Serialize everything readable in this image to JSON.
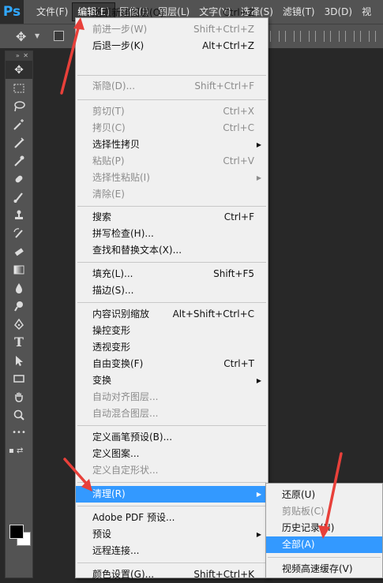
{
  "app": {
    "logo": "Ps"
  },
  "menubar": {
    "items": [
      "文件(F)",
      "编辑(E)",
      "图像(I)",
      "图层(L)",
      "文字(Y)",
      "选择(S)",
      "滤镜(T)",
      "3D(D)",
      "视"
    ]
  },
  "edit_menu": {
    "items": [
      {
        "label": "还原新建图层(O)",
        "shortcut": "Ctrl+Z",
        "disabled": false
      },
      {
        "label": "前进一步(W)",
        "shortcut": "Shift+Ctrl+Z",
        "disabled": true
      },
      {
        "label": "后退一步(K)",
        "shortcut": "Alt+Ctrl+Z",
        "disabled": false
      },
      {
        "label": "渐隐(D)...",
        "shortcut": "Shift+Ctrl+F",
        "disabled": true
      },
      {
        "label": "剪切(T)",
        "shortcut": "Ctrl+X",
        "disabled": true
      },
      {
        "label": "拷贝(C)",
        "shortcut": "Ctrl+C",
        "disabled": true
      },
      {
        "label": "选择性拷贝",
        "shortcut": "",
        "disabled": false,
        "submenu": true
      },
      {
        "label": "粘贴(P)",
        "shortcut": "Ctrl+V",
        "disabled": true
      },
      {
        "label": "选择性粘贴(I)",
        "shortcut": "",
        "disabled": true,
        "submenu": true
      },
      {
        "label": "清除(E)",
        "shortcut": "",
        "disabled": true
      },
      {
        "label": "搜索",
        "shortcut": "Ctrl+F",
        "disabled": false
      },
      {
        "label": "拼写检查(H)...",
        "shortcut": "",
        "disabled": false
      },
      {
        "label": "查找和替换文本(X)...",
        "shortcut": "",
        "disabled": false
      },
      {
        "label": "填充(L)...",
        "shortcut": "Shift+F5",
        "disabled": false
      },
      {
        "label": "描边(S)...",
        "shortcut": "",
        "disabled": false
      },
      {
        "label": "内容识别缩放",
        "shortcut": "Alt+Shift+Ctrl+C",
        "disabled": false
      },
      {
        "label": "操控变形",
        "shortcut": "",
        "disabled": false
      },
      {
        "label": "透视变形",
        "shortcut": "",
        "disabled": false
      },
      {
        "label": "自由变换(F)",
        "shortcut": "Ctrl+T",
        "disabled": false
      },
      {
        "label": "变换",
        "shortcut": "",
        "disabled": false,
        "submenu": true
      },
      {
        "label": "自动对齐图层...",
        "shortcut": "",
        "disabled": true
      },
      {
        "label": "自动混合图层...",
        "shortcut": "",
        "disabled": true
      },
      {
        "label": "定义画笔预设(B)...",
        "shortcut": "",
        "disabled": false
      },
      {
        "label": "定义图案...",
        "shortcut": "",
        "disabled": false
      },
      {
        "label": "定义自定形状...",
        "shortcut": "",
        "disabled": true
      },
      {
        "label": "清理(R)",
        "shortcut": "",
        "disabled": false,
        "submenu": true,
        "highlighted": true
      },
      {
        "label": "Adobe PDF 预设...",
        "shortcut": "",
        "disabled": false
      },
      {
        "label": "预设",
        "shortcut": "",
        "disabled": false,
        "submenu": true
      },
      {
        "label": "远程连接...",
        "shortcut": "",
        "disabled": false
      },
      {
        "label": "颜色设置(G)...",
        "shortcut": "Shift+Ctrl+K",
        "disabled": false
      }
    ]
  },
  "purge_submenu": {
    "items": [
      {
        "label": "还原(U)",
        "disabled": false
      },
      {
        "label": "剪贴板(C)",
        "disabled": true
      },
      {
        "label": "历史记录(H)",
        "disabled": false
      },
      {
        "label": "全部(A)",
        "disabled": false,
        "highlighted": true
      },
      {
        "label": "视频高速缓存(V)",
        "disabled": false
      }
    ]
  },
  "colors": {
    "highlight": "#3399ff",
    "annotation_arrow": "#e8403a",
    "ps_blue": "#31a8ff"
  }
}
